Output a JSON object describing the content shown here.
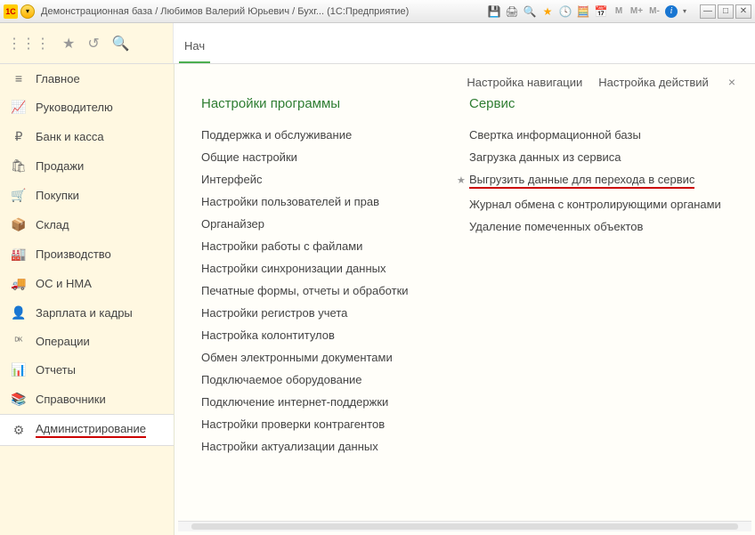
{
  "titlebar": {
    "title": "Демонстрационная база / Любимов Валерий Юрьевич / Бухг...   (1С:Предприятие)"
  },
  "topbar": {
    "tab_label": "Нач"
  },
  "sidebar": {
    "items": [
      {
        "icon": "≡",
        "label": "Главное"
      },
      {
        "icon": "📈",
        "label": "Руководителю"
      },
      {
        "icon": "₽",
        "label": "Банк и касса"
      },
      {
        "icon": "🛍",
        "label": "Продажи"
      },
      {
        "icon": "🛒",
        "label": "Покупки"
      },
      {
        "icon": "📦",
        "label": "Склад"
      },
      {
        "icon": "🏭",
        "label": "Производство"
      },
      {
        "icon": "🚚",
        "label": "ОС и НМА"
      },
      {
        "icon": "👤",
        "label": "Зарплата и кадры"
      },
      {
        "icon": "ᴰᴷ",
        "label": "Операции"
      },
      {
        "icon": "📊",
        "label": "Отчеты"
      },
      {
        "icon": "📚",
        "label": "Справочники"
      },
      {
        "icon": "⚙",
        "label": "Администрирование"
      }
    ]
  },
  "content": {
    "header": {
      "nav_settings": "Настройка навигации",
      "action_settings": "Настройка действий"
    },
    "col1": {
      "title": "Настройки программы",
      "items": [
        "Поддержка и обслуживание",
        "Общие настройки",
        "Интерфейс",
        "Настройки пользователей и прав",
        "Органайзер",
        "Настройки работы с файлами",
        "Настройки синхронизации данных",
        "Печатные формы, отчеты и обработки",
        "Настройки регистров учета",
        "Настройка колонтитулов",
        "Обмен электронными документами",
        "Подключаемое оборудование",
        "Подключение интернет-поддержки",
        "Настройки проверки контрагентов",
        "Настройки актуализации данных"
      ]
    },
    "col2": {
      "title": "Сервис",
      "items": [
        "Свертка информационной базы",
        "Загрузка данных из сервиса",
        "Выгрузить данные для перехода в сервис",
        "Журнал обмена с контролирующими органами",
        "Удаление помеченных объектов"
      ],
      "highlighted_index": 2
    }
  }
}
